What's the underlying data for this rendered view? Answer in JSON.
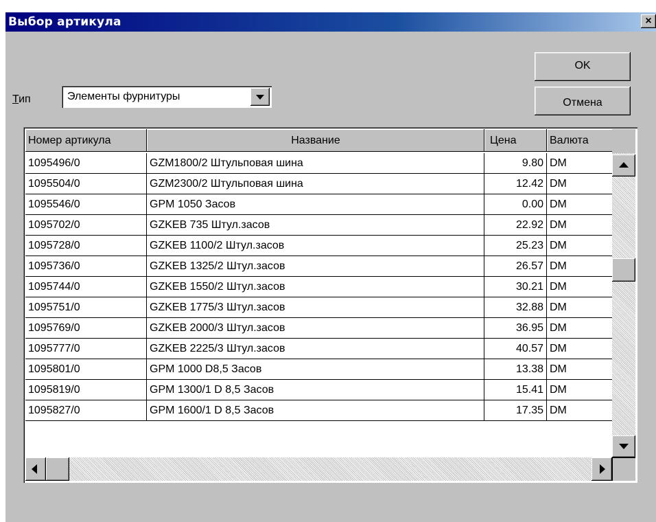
{
  "window": {
    "title": "Выбор артикула",
    "close_symbol": "×"
  },
  "buttons": {
    "ok": "OK",
    "cancel": "Отмена"
  },
  "type_field": {
    "label_accel": "Т",
    "label_rest": "ип",
    "value": "Элементы фурнитуры"
  },
  "table": {
    "headers": [
      "Номер артикула",
      "Название",
      "Цена",
      "Валюта"
    ],
    "rows": [
      [
        "1095496/0",
        "GZM1800/2 Штульповая шина",
        "9.80",
        "DM"
      ],
      [
        "1095504/0",
        "GZM2300/2 Штульповая шина",
        "12.42",
        "DM"
      ],
      [
        "1095546/0",
        "GPM 1050 Засов",
        "0.00",
        "DM"
      ],
      [
        "1095702/0",
        "GZKEB 735 Штул.засов",
        "22.92",
        "DM"
      ],
      [
        "1095728/0",
        "GZKEB 1100/2 Штул.засов",
        "25.23",
        "DM"
      ],
      [
        "1095736/0",
        "GZKEB 1325/2 Штул.засов",
        "26.57",
        "DM"
      ],
      [
        "1095744/0",
        "GZKEB 1550/2 Штул.засов",
        "30.21",
        "DM"
      ],
      [
        "1095751/0",
        "GZKEB 1775/3 Штул.засов",
        "32.88",
        "DM"
      ],
      [
        "1095769/0",
        "GZKEB 2000/3 Штул.засов",
        "36.95",
        "DM"
      ],
      [
        "1095777/0",
        "GZKEB 2225/3 Штул.засов",
        "40.57",
        "DM"
      ],
      [
        "1095801/0",
        "GPM 1000 D8,5 Засов",
        "13.38",
        "DM"
      ],
      [
        "1095819/0",
        "GPM 1300/1 D 8,5 Засов",
        "15.41",
        "DM"
      ],
      [
        "1095827/0",
        "GPM 1600/1 D 8,5 Засов",
        "17.35",
        "DM"
      ]
    ]
  },
  "colors": {
    "titlebar_start": "#000080",
    "titlebar_end": "#a9c8ea",
    "dialog_face": "#c0c0c0"
  }
}
